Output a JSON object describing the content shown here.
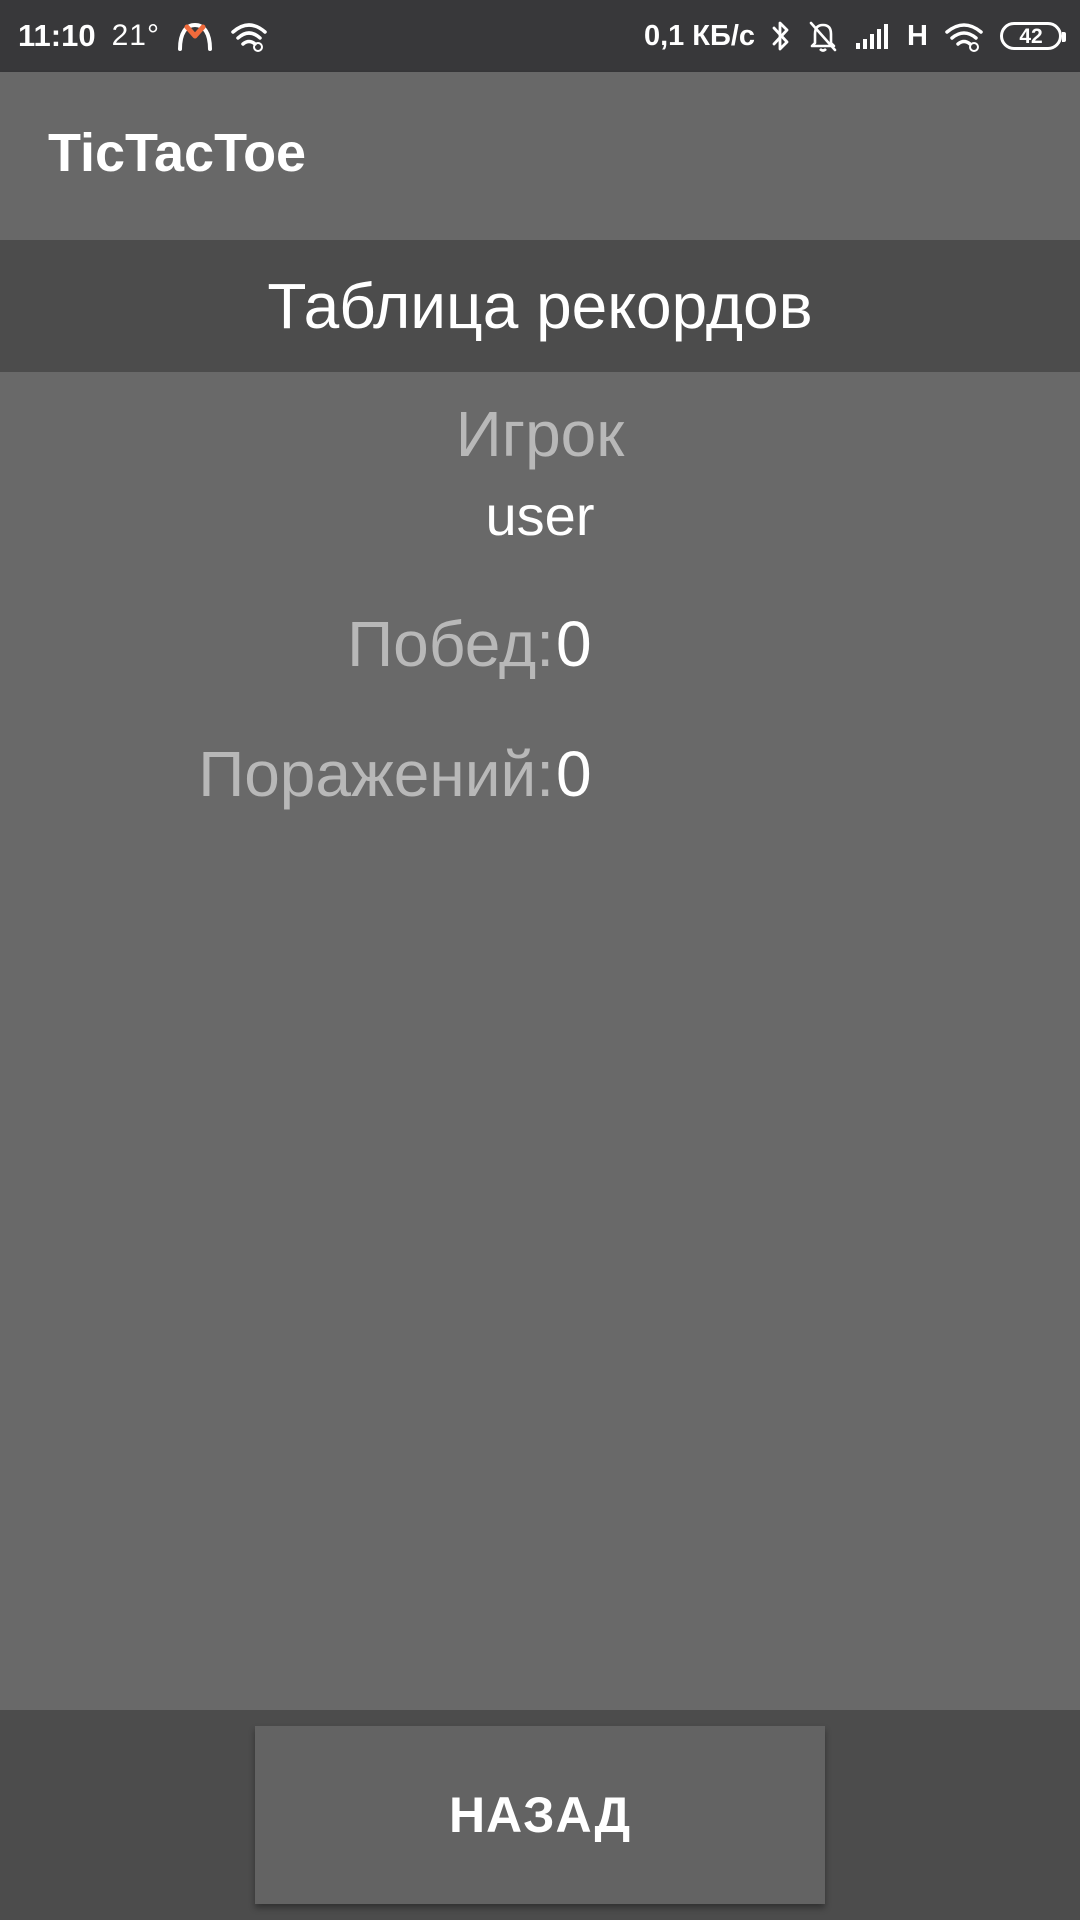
{
  "status_bar": {
    "time": "11:10",
    "temperature": "21°",
    "speed": "0,1 КБ/с",
    "network_type": "H",
    "battery": "42",
    "icons": [
      "app-notification-icon",
      "wifi-icon",
      "bluetooth-icon",
      "bell-muted-icon",
      "signal-icon",
      "wifi-icon",
      "battery-icon"
    ]
  },
  "app_bar": {
    "title": "TicTacToe"
  },
  "header": {
    "title": "Таблица рекордов"
  },
  "scores": {
    "player_label": "Игрок",
    "player_name": "user",
    "wins_label": "Побед:",
    "wins_value": "0",
    "losses_label": "Поражений:",
    "losses_value": "0"
  },
  "footer": {
    "back_label": "НАЗАД"
  },
  "colors": {
    "status_bar_bg": "#38383a",
    "app_bar_bg": "#686868",
    "band_bg": "#4c4c4c",
    "content_bg": "#696969",
    "label_text": "#b8b8b8",
    "value_text": "#ffffff",
    "button_bg": "#636363",
    "notification_accent": "#f06a3b"
  }
}
